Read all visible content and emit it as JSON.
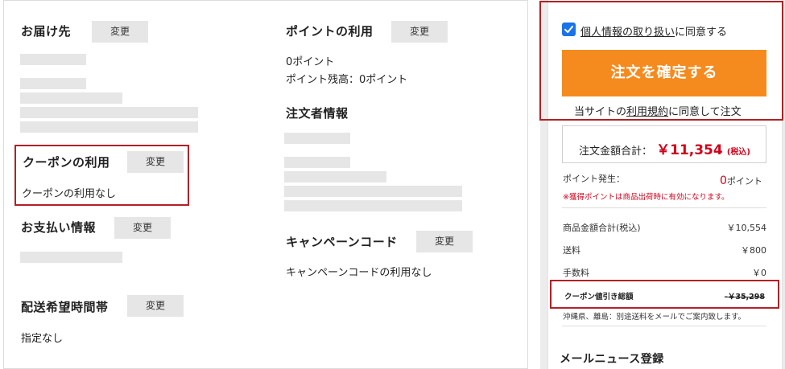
{
  "left": {
    "delivery": {
      "heading": "お届け先",
      "change_label": "変更"
    },
    "coupon": {
      "heading": "クーポンの利用",
      "change_label": "変更",
      "value": "クーポンの利用なし"
    },
    "payment": {
      "heading": "お支払い情報",
      "change_label": "変更"
    },
    "delivery_time": {
      "heading": "配送希望時間帯",
      "change_label": "変更",
      "value": "指定なし"
    },
    "points": {
      "heading": "ポイントの利用",
      "change_label": "変更",
      "used": "0ポイント",
      "balance": "ポイント残高：0ポイント"
    },
    "orderer": {
      "heading": "注文者情報"
    },
    "campaign": {
      "heading": "キャンペーンコード",
      "change_label": "変更",
      "value": "キャンペーンコードの利用なし"
    }
  },
  "right": {
    "consent": {
      "link_text": "個人情報の取り扱い",
      "suffix": "に同意する",
      "checked": true
    },
    "confirm_button": "注文を確定する",
    "terms": {
      "prefix": "当サイトの",
      "link_text": "利用規約",
      "suffix": "に同意して注文"
    },
    "total": {
      "label": "注文金額合計：",
      "amount": "￥11,354",
      "tax": "(税込)"
    },
    "points_earned": {
      "label": "ポイント発生：",
      "value": "0",
      "unit": "ポイント",
      "note": "※獲得ポイントは商品出荷時に有効になります。"
    },
    "lines": [
      {
        "label": "商品金額合計(税込)",
        "value": "￥10,554"
      },
      {
        "label": "送料",
        "value": "￥800"
      },
      {
        "label": "手数料",
        "value": "￥0"
      }
    ],
    "coupon_discount": {
      "label": "クーポン値引き総額",
      "value": "-￥35,298"
    },
    "shipping_note": "沖縄県、離島：別途送料をメールでご案内致します。",
    "newsletter_heading": "メールニュース登録"
  },
  "colors": {
    "accent": "#f58b1f",
    "highlight_border": "#b32025",
    "price_red": "#d0021b",
    "checkbox": "#1a73e8"
  }
}
